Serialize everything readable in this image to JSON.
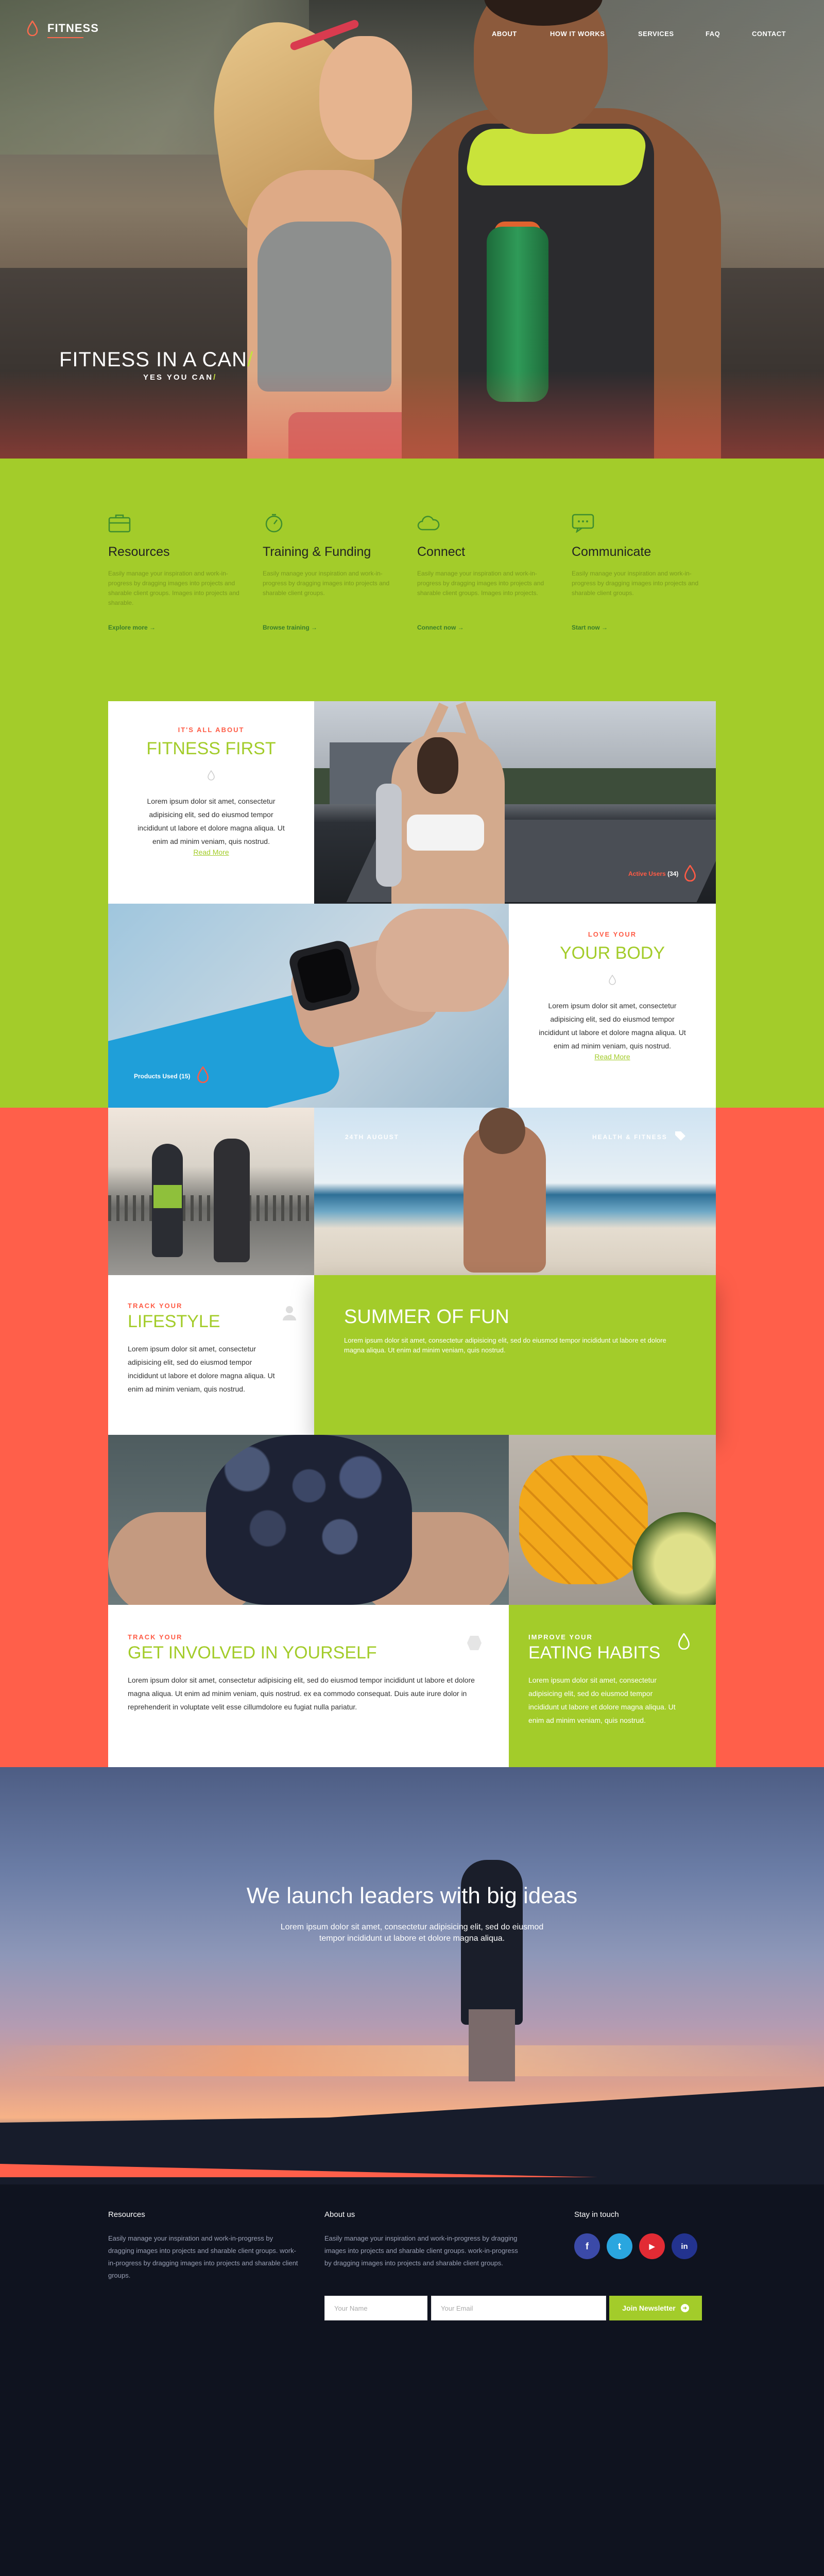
{
  "brand": {
    "name": "FITNESS",
    "accent": "#ff6a4d",
    "green": "#a3cc2a",
    "coral": "#ff5f4a",
    "navy": "#0f131f"
  },
  "nav": {
    "items": [
      "ABOUT",
      "HOW IT WORKS",
      "SERVICES",
      "FAQ",
      "CONTACT"
    ]
  },
  "hero": {
    "title": "FITNESS IN A CAN",
    "title_slash": "/",
    "subtitle": "YES YOU CAN",
    "subtitle_slash": "/"
  },
  "features": [
    {
      "icon": "briefcase-icon",
      "title": "Resources",
      "text": "Easily manage your inspiration and work-in-progress by dragging images into projects and sharable client groups. Images into projects and sharable.",
      "link": "Explore more →"
    },
    {
      "icon": "stopwatch-icon",
      "title": "Training & Funding",
      "text": "Easily manage your inspiration and work-in-progress by dragging images into projects and sharable client groups.",
      "link": "Browse training →"
    },
    {
      "icon": "cloud-icon",
      "title": "Connect",
      "text": "Easily manage your inspiration and work-in-progress by dragging images into projects and sharable client groups. Images into projects.",
      "link": "Connect now →"
    },
    {
      "icon": "chat-icon",
      "title": "Communicate",
      "text": "Easily manage your inspiration and work-in-progress by dragging images into projects and sharable client groups.",
      "link": "Start now →"
    }
  ],
  "card_fitness": {
    "kicker": "IT'S ALL ABOUT",
    "title": "FITNESS FIRST",
    "body": "Lorem ipsum dolor sit amet, consectetur adipisicing elit, sed do eiusmod tempor incididunt ut labore et dolore magna aliqua. Ut enim ad minim veniam, quis nostrud.",
    "link": "Read More"
  },
  "badge_users": {
    "label": "Active Users",
    "count": "(34)"
  },
  "card_body": {
    "kicker": "LOVE YOUR",
    "title": "YOUR BODY",
    "body": "Lorem ipsum dolor sit amet, consectetur adipisicing elit, sed do eiusmod tempor incididunt ut labore et dolore magna aliqua. Ut enim ad minim veniam, quis nostrud.",
    "link": "Read More"
  },
  "badge_products": {
    "label": "Products Used (15)"
  },
  "beach": {
    "date": "24TH AUGUST",
    "tag": "HEALTH & FITNESS"
  },
  "card_lifestyle": {
    "kicker": "TRACK YOUR",
    "title": "LIFESTYLE",
    "body": "Lorem ipsum dolor sit amet, consectetur adipisicing elit, sed do eiusmod tempor incididunt ut labore et dolore magna aliqua. Ut enim ad minim veniam, quis nostrud."
  },
  "card_summer": {
    "title": "SUMMER OF FUN",
    "body": "Lorem ipsum dolor sit amet, consectetur adipisicing elit, sed do eiusmod tempor incididunt ut labore et dolore magna aliqua. Ut enim ad minim veniam, quis nostrud."
  },
  "card_involved": {
    "kicker": "TRACK YOUR",
    "title": "GET INVOLVED IN YOURSELF",
    "body": "Lorem ipsum dolor sit amet, consectetur adipisicing elit, sed do eiusmod tempor incididunt ut labore et dolore magna aliqua. Ut enim ad minim veniam, quis nostrud. ex ea commodo consequat. Duis aute irure dolor in reprehenderit in voluptate velit esse cillumdolore eu fugiat nulla pariatur."
  },
  "card_eating": {
    "kicker": "IMPROVE YOUR",
    "title": "EATING HABITS",
    "body": "Lorem ipsum dolor sit amet, consectetur adipisicing elit, sed do eiusmod tempor incididunt ut labore et dolore magna aliqua. Ut enim ad minim veniam, quis nostrud."
  },
  "banner": {
    "title": "We launch leaders with big ideas",
    "subtitle": "Lorem ipsum dolor sit amet, consectetur adipisicing elit, sed do eiusmod tempor incididunt ut labore et dolore magna aliqua."
  },
  "footer": {
    "resources": {
      "heading": "Resources",
      "text": "Easily manage your inspiration and work-in-progress by dragging images into projects and sharable client groups. work-in-progress by dragging images into projects and sharable client groups."
    },
    "about": {
      "heading": "About us",
      "text": "Easily manage your inspiration and work-in-progress by dragging images into projects and sharable client groups. work-in-progress by dragging images into projects and sharable client groups."
    },
    "social": {
      "heading": "Stay in touch",
      "items": [
        {
          "icon": "facebook-icon",
          "glyph": "f",
          "color": "#3b4aa8"
        },
        {
          "icon": "twitter-icon",
          "glyph": "t",
          "color": "#2aa6df"
        },
        {
          "icon": "youtube-icon",
          "glyph": "▶",
          "color": "#e22b34"
        },
        {
          "icon": "linkedin-icon",
          "glyph": "in",
          "color": "#23338f"
        }
      ]
    },
    "newsletter": {
      "name_placeholder": "Your Name",
      "email_placeholder": "Your Email",
      "button": "Join Newsletter"
    }
  }
}
